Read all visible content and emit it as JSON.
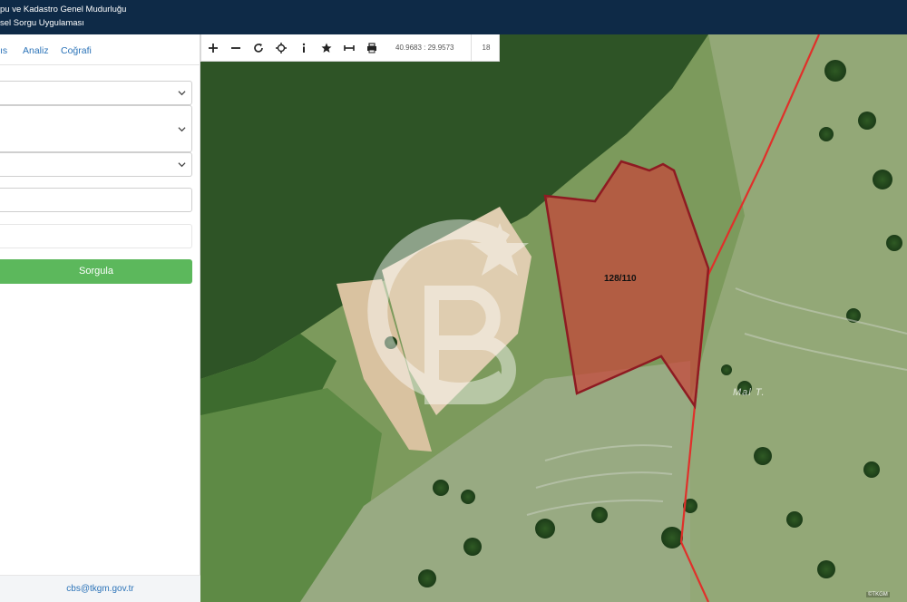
{
  "header": {
    "title_line1": "pu ve Kadastro Genel Mudurluğu",
    "title_line2": "sel Sorgu Uygulaması"
  },
  "nav": {
    "tabs": [
      {
        "label": "ıs"
      },
      {
        "label": "Analiz"
      },
      {
        "label": "Coğrafi"
      }
    ]
  },
  "form": {
    "submit_label": "Sorgula"
  },
  "footer": {
    "email": "cbs@tkgm.gov.tr"
  },
  "toolbar": {
    "icons": [
      "zoom-in-icon",
      "zoom-out-icon",
      "refresh-icon",
      "locate-icon",
      "info-icon",
      "favorite-icon",
      "measure-icon",
      "print-icon"
    ],
    "coordinates": "40.9683 : 29.9573",
    "zoom_level": "18"
  },
  "map": {
    "parcel_label": "128/110",
    "place_label": "Mal T.",
    "attribution": "©TKGM",
    "colors": {
      "parcel_fill": "#c8453a",
      "parcel_border": "#8e1b22",
      "boundary_line": "#e0302a",
      "header_bg": "#0e2a47",
      "submit_bg": "#5cb85c"
    }
  }
}
